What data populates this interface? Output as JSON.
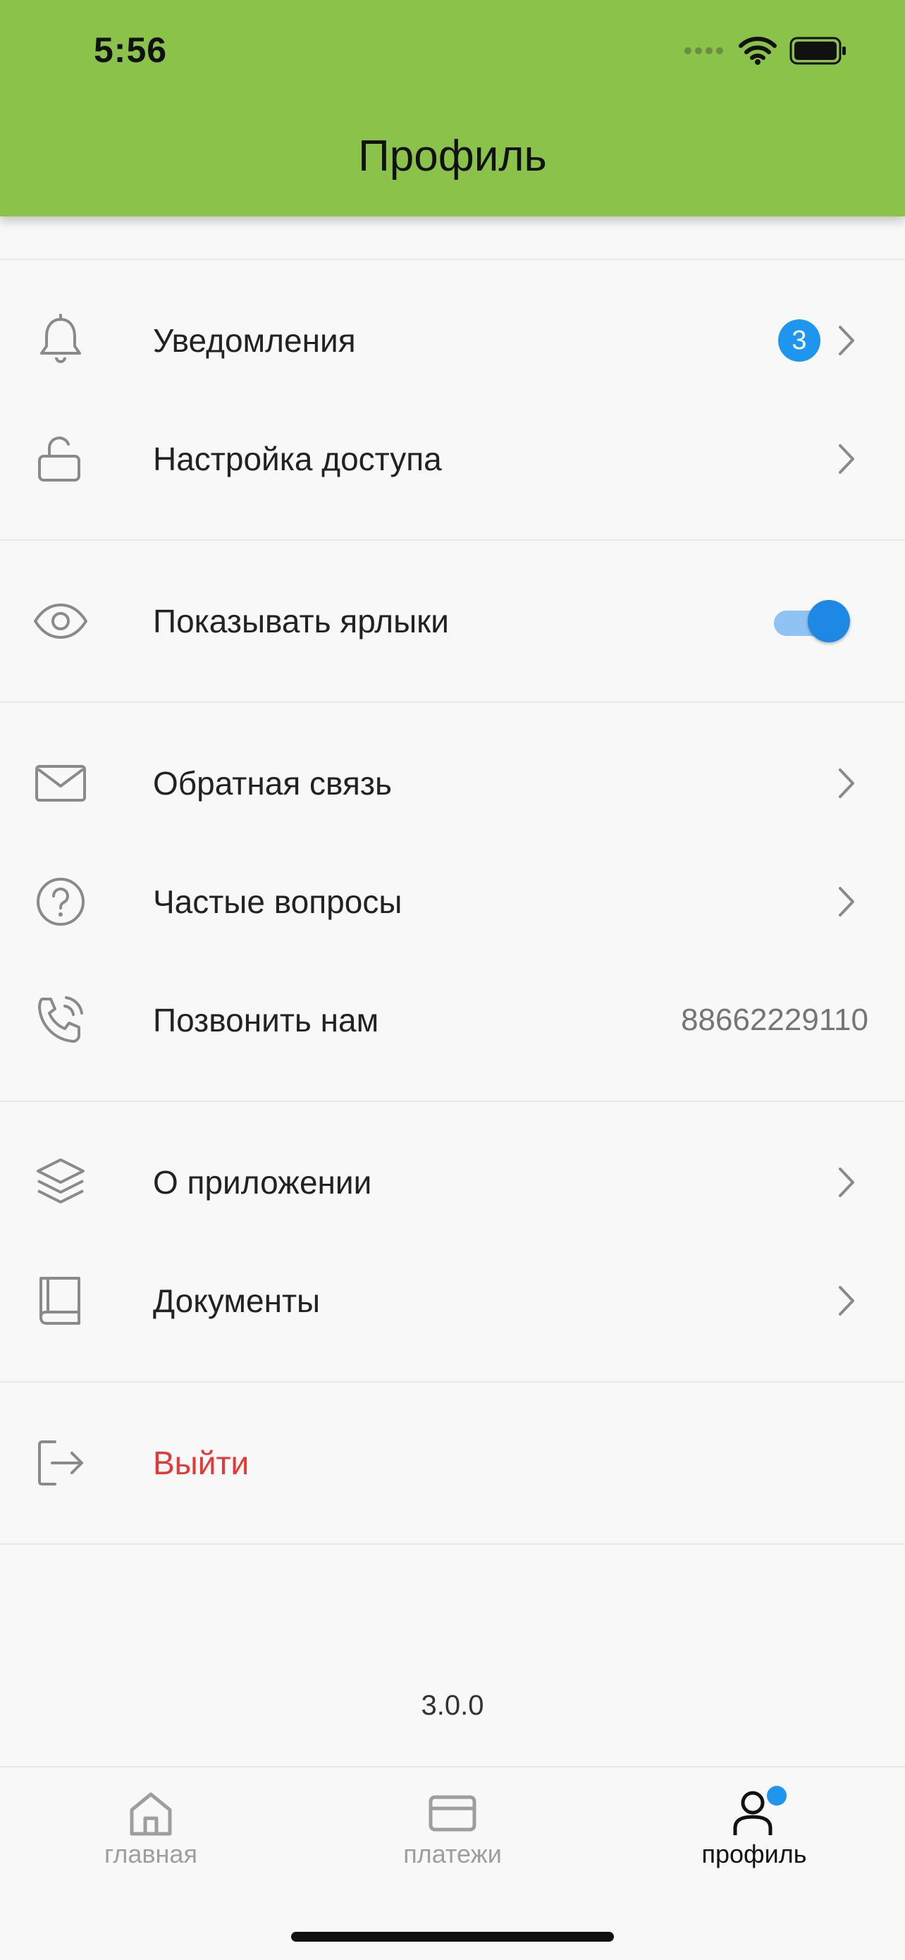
{
  "status": {
    "time": "5:56"
  },
  "header": {
    "title": "Профиль"
  },
  "menu": {
    "notifications": {
      "label": "Уведомления",
      "badge": "3",
      "icon": "bell-icon"
    },
    "access": {
      "label": "Настройка доступа",
      "icon": "lock-open-icon"
    },
    "shortcuts": {
      "label": "Показывать ярлыки",
      "enabled": true,
      "icon": "eye-icon"
    },
    "feedback": {
      "label": "Обратная связь",
      "icon": "mail-icon"
    },
    "faq": {
      "label": "Частые вопросы",
      "icon": "question-icon"
    },
    "call": {
      "label": "Позвонить нам",
      "phone": "88662229110",
      "icon": "phone-icon"
    },
    "about": {
      "label": "О приложении",
      "icon": "layers-icon"
    },
    "documents": {
      "label": "Документы",
      "icon": "book-icon"
    },
    "logout": {
      "label": "Выйти",
      "icon": "logout-icon"
    }
  },
  "version": "3.0.0",
  "tabs": {
    "home": {
      "label": "главная"
    },
    "payments": {
      "label": "платежи"
    },
    "profile": {
      "label": "профиль"
    }
  },
  "colors": {
    "header": "#8bc34a",
    "badge": "#1e96f0",
    "toggle": "#1e88e5",
    "logout": "#e53935"
  }
}
